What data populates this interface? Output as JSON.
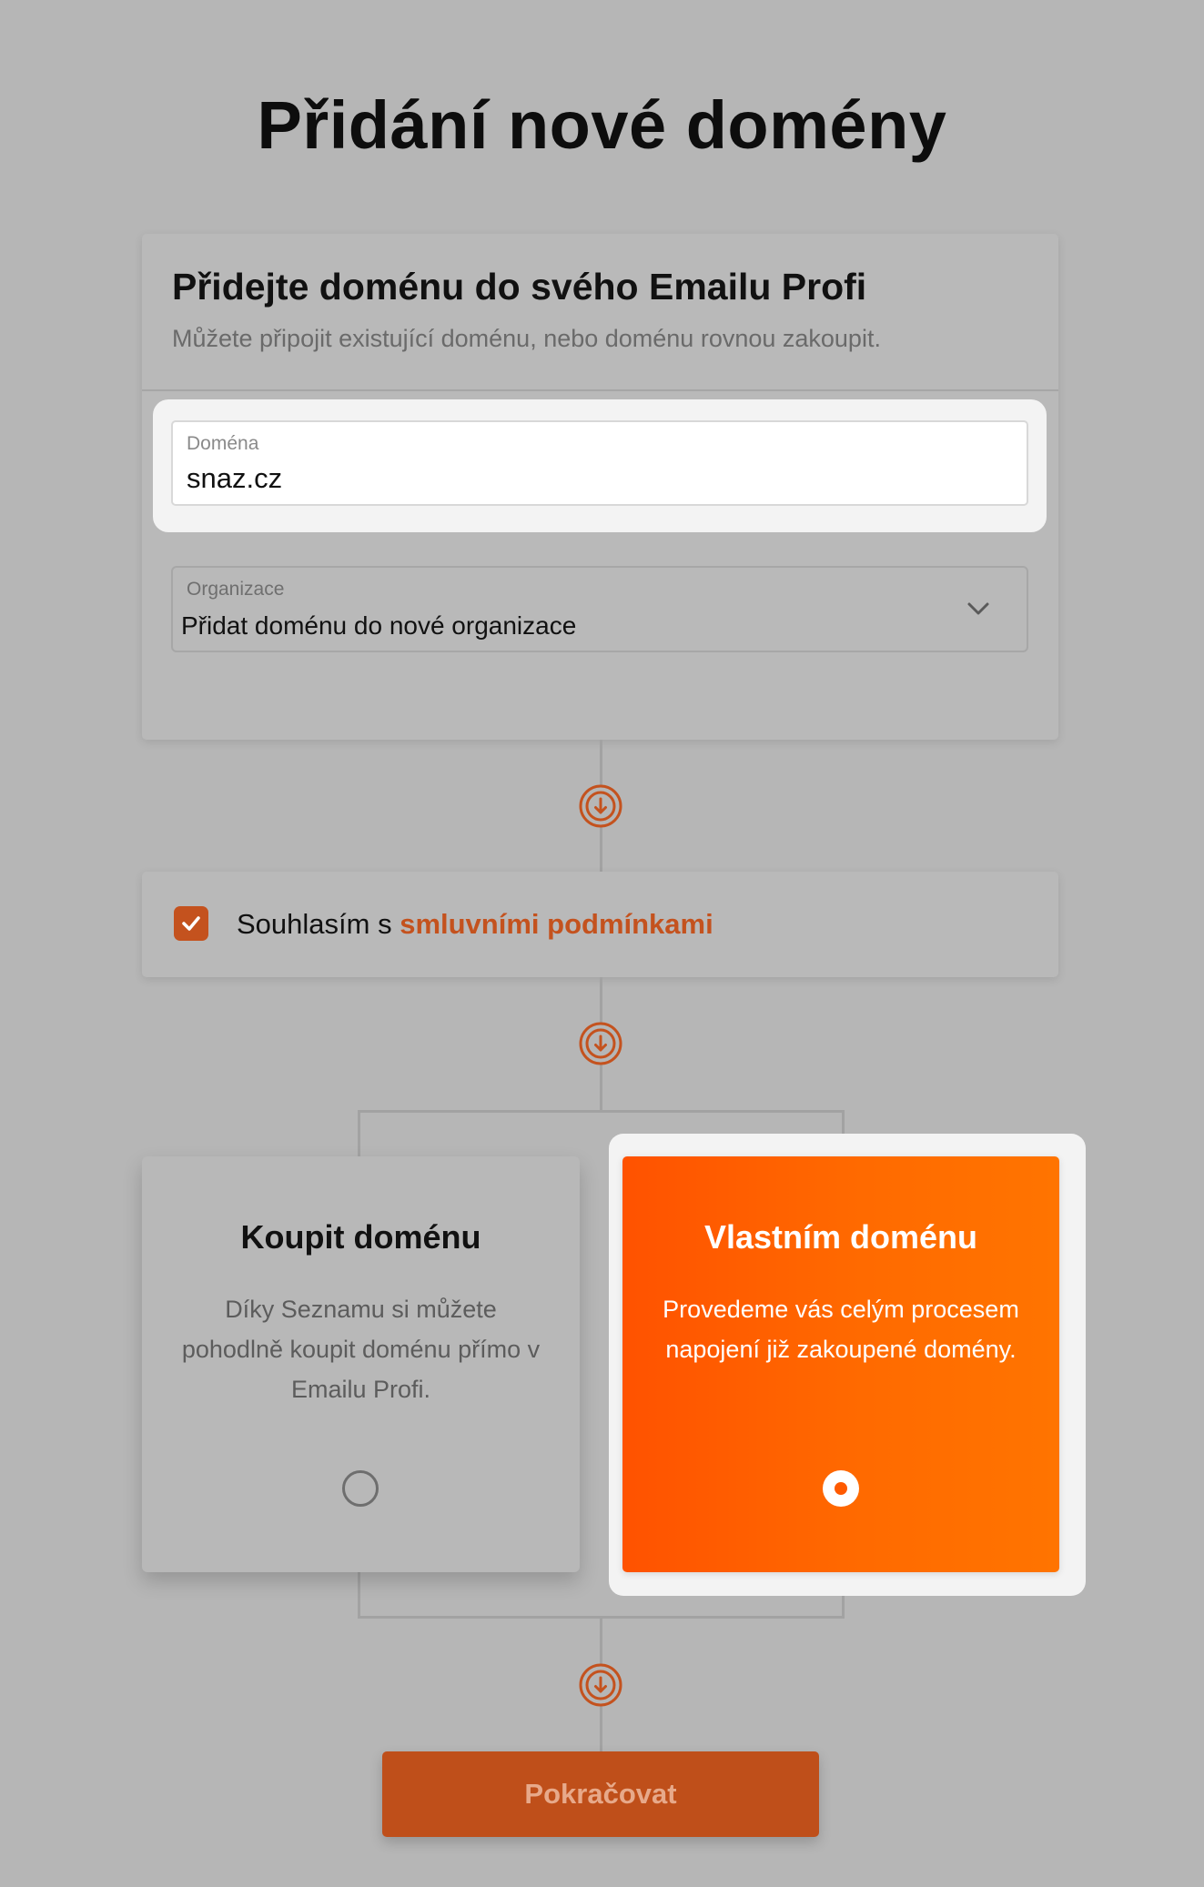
{
  "page": {
    "title": "Přidání nové domény"
  },
  "domain_card": {
    "title": "Přidejte doménu do svého Emailu Profi",
    "subtitle": "Můžete připojit existující doménu, nebo doménu rovnou zakoupit.",
    "domain_field": {
      "label": "Doména",
      "value": "snaz.cz"
    },
    "organization_select": {
      "label": "Organizace",
      "selected": "Přidat doménu do nové organizace"
    }
  },
  "terms": {
    "prefix": "Souhlasím s ",
    "link_text": "smluvními podmínkami",
    "checked": true
  },
  "options": [
    {
      "title": "Koupit doménu",
      "description": "Díky Seznamu si můžete pohodlně koupit doménu přímo v Emailu Profi.",
      "selected": false
    },
    {
      "title": "Vlastním doménu",
      "description": "Provedeme vás celým procesem napojení již zakoupené domény.",
      "selected": true
    }
  ],
  "actions": {
    "continue_label": "Pokračovat"
  },
  "colors": {
    "accent": "#c4521e",
    "selected_card": "#ff6a00",
    "background": "#b6b6b6"
  },
  "icons": {
    "step": "arrow-down-circle-icon",
    "select": "chevron-down-icon",
    "checkbox": "check-icon"
  }
}
